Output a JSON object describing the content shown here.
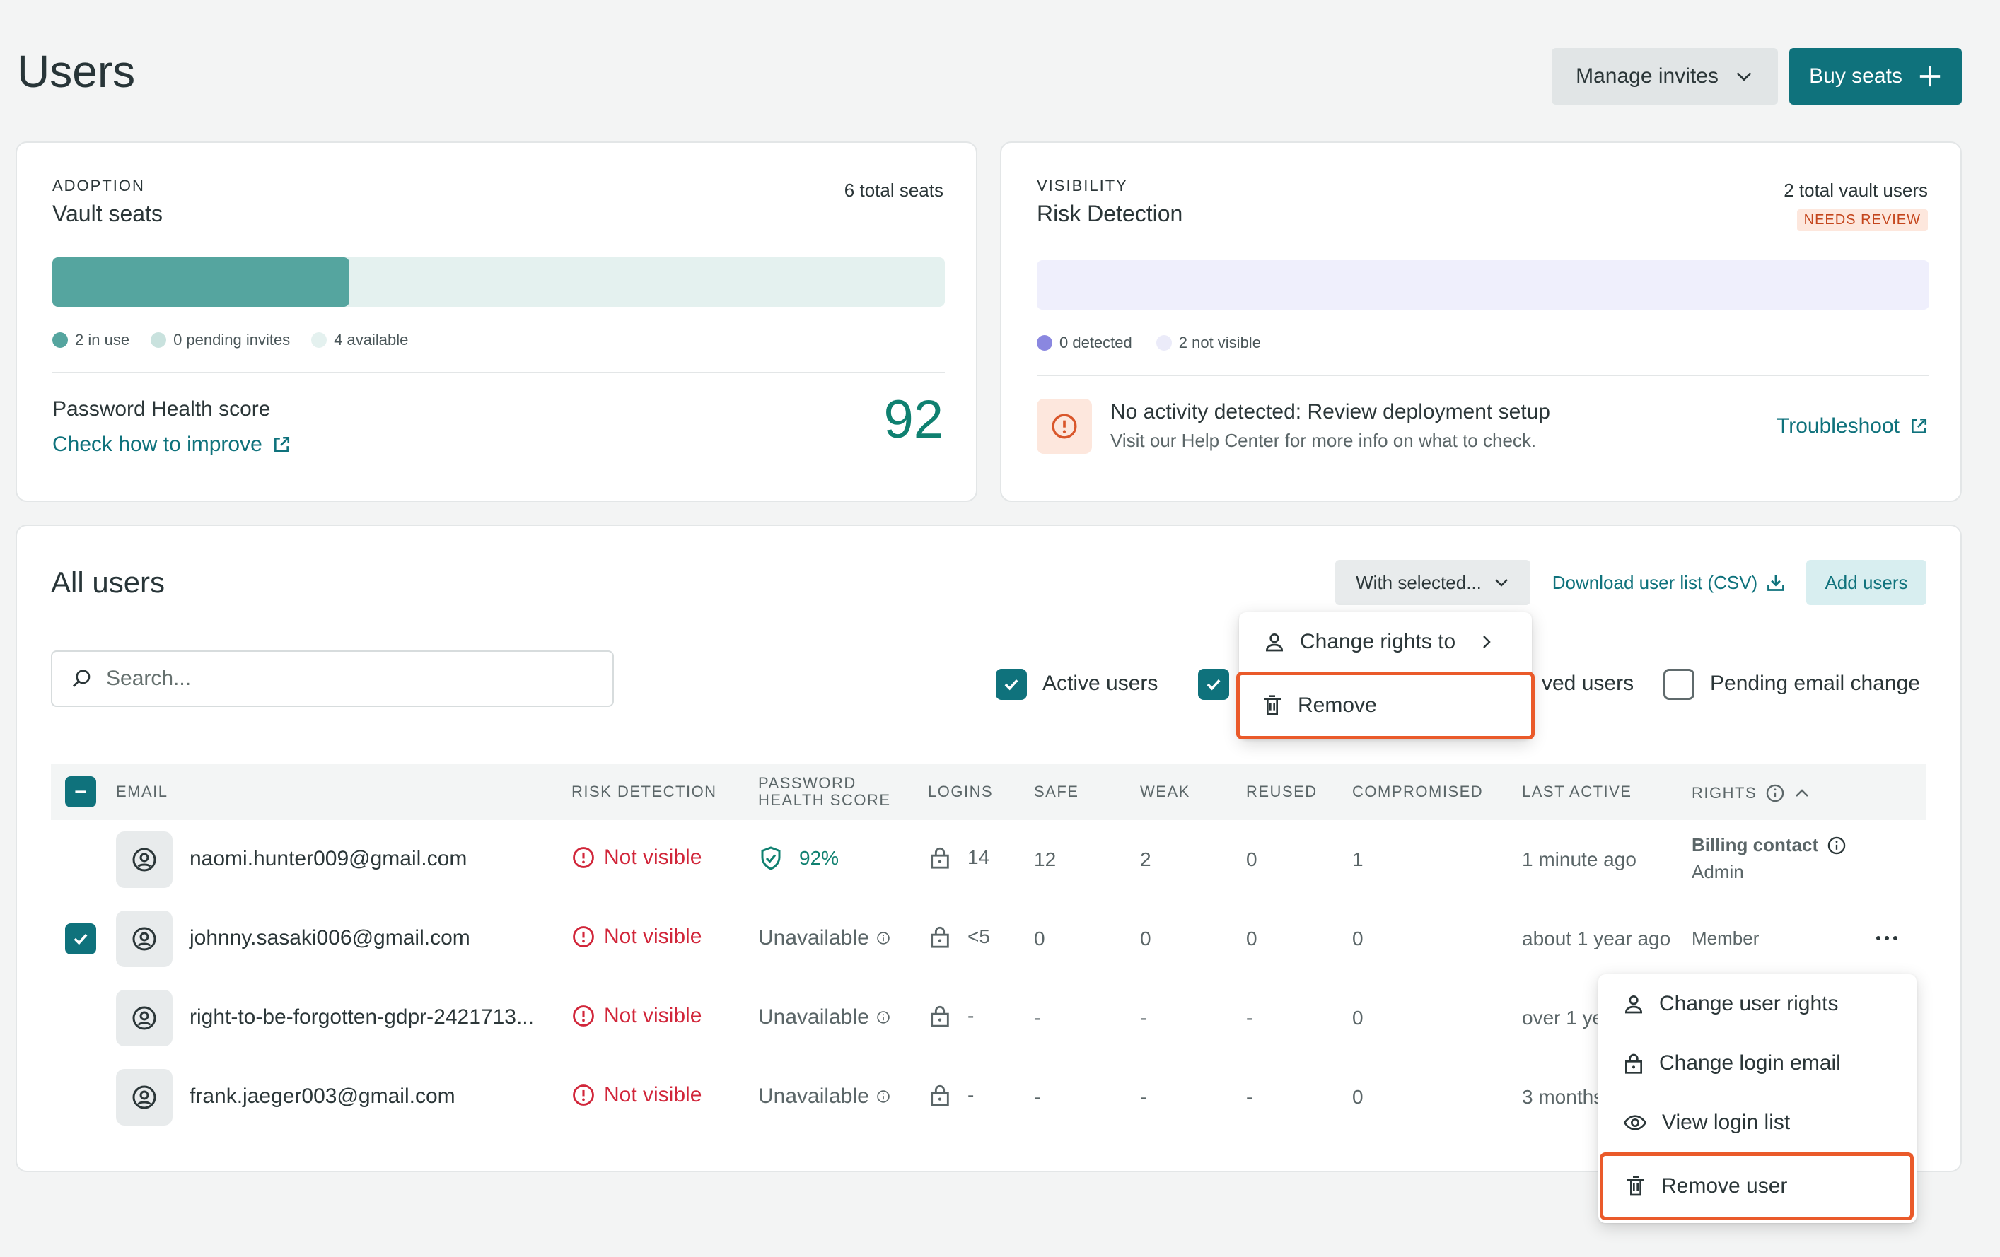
{
  "header": {
    "title": "Users",
    "manage_invites": "Manage invites",
    "buy_seats": "Buy seats"
  },
  "adoption": {
    "overline": "ADOPTION",
    "title": "Vault seats",
    "total": "6 total seats",
    "in_use_fraction": 0.333,
    "legend": {
      "in_use": "2 in use",
      "pending": "0 pending invites",
      "available": "4 available"
    },
    "health_label": "Password Health score",
    "improve_link": "Check how to improve",
    "score": "92"
  },
  "visibility": {
    "overline": "VISIBILITY",
    "title": "Risk Detection",
    "total": "2 total vault users",
    "badge": "NEEDS REVIEW",
    "legend": {
      "detected": "0 detected",
      "not_visible": "2 not visible"
    },
    "alert_title": "No activity detected: Review deployment setup",
    "alert_sub": "Visit our Help Center for more info on what to check.",
    "troubleshoot": "Troubleshoot"
  },
  "all_users": {
    "title": "All users",
    "with_selected": "With selected...",
    "download": "Download user list (CSV)",
    "add_users": "Add users",
    "search_placeholder": "Search...",
    "filters": {
      "active": "Active users",
      "removed_partial": "ved users",
      "pending_email": "Pending email change"
    },
    "columns": {
      "email": "EMAIL",
      "risk": "RISK DETECTION",
      "health_1": "PASSWORD",
      "health_2": "HEALTH SCORE",
      "logins": "LOGINS",
      "safe": "SAFE",
      "weak": "WEAK",
      "reused": "REUSED",
      "compromised": "COMPROMISED",
      "last_active": "LAST ACTIVE",
      "rights": "RIGHTS"
    },
    "rows": [
      {
        "email": "naomi.hunter009@gmail.com",
        "risk": "Not visible",
        "health": "92%",
        "logins": "14",
        "safe": "12",
        "weak": "2",
        "reused": "0",
        "compromised": "1",
        "last_active": "1 minute ago",
        "rights": "Billing contact",
        "rights_sub": "Admin"
      },
      {
        "email": "johnny.sasaki006@gmail.com",
        "risk": "Not visible",
        "health": "Unavailable",
        "logins": "<5",
        "safe": "0",
        "weak": "0",
        "reused": "0",
        "compromised": "0",
        "last_active": "about 1 year ago",
        "rights": "Member"
      },
      {
        "email": "right-to-be-forgotten-gdpr-2421713...",
        "risk": "Not visible",
        "health": "Unavailable",
        "logins": "-",
        "safe": "-",
        "weak": "-",
        "reused": "-",
        "compromised": "0",
        "last_active": "over 1 yea"
      },
      {
        "email": "frank.jaeger003@gmail.com",
        "risk": "Not visible",
        "health": "Unavailable",
        "logins": "-",
        "safe": "-",
        "weak": "-",
        "reused": "-",
        "compromised": "0",
        "last_active": "3 months"
      }
    ]
  },
  "bulk_menu": {
    "change_rights": "Change rights to",
    "remove": "Remove"
  },
  "row_menu": {
    "change_rights": "Change user rights",
    "change_login": "Change login email",
    "view_logins": "View login list",
    "remove_user": "Remove user"
  },
  "colors": {
    "brand": "#0f727c",
    "danger": "#d1263a",
    "highlight": "#ea5a2a"
  }
}
